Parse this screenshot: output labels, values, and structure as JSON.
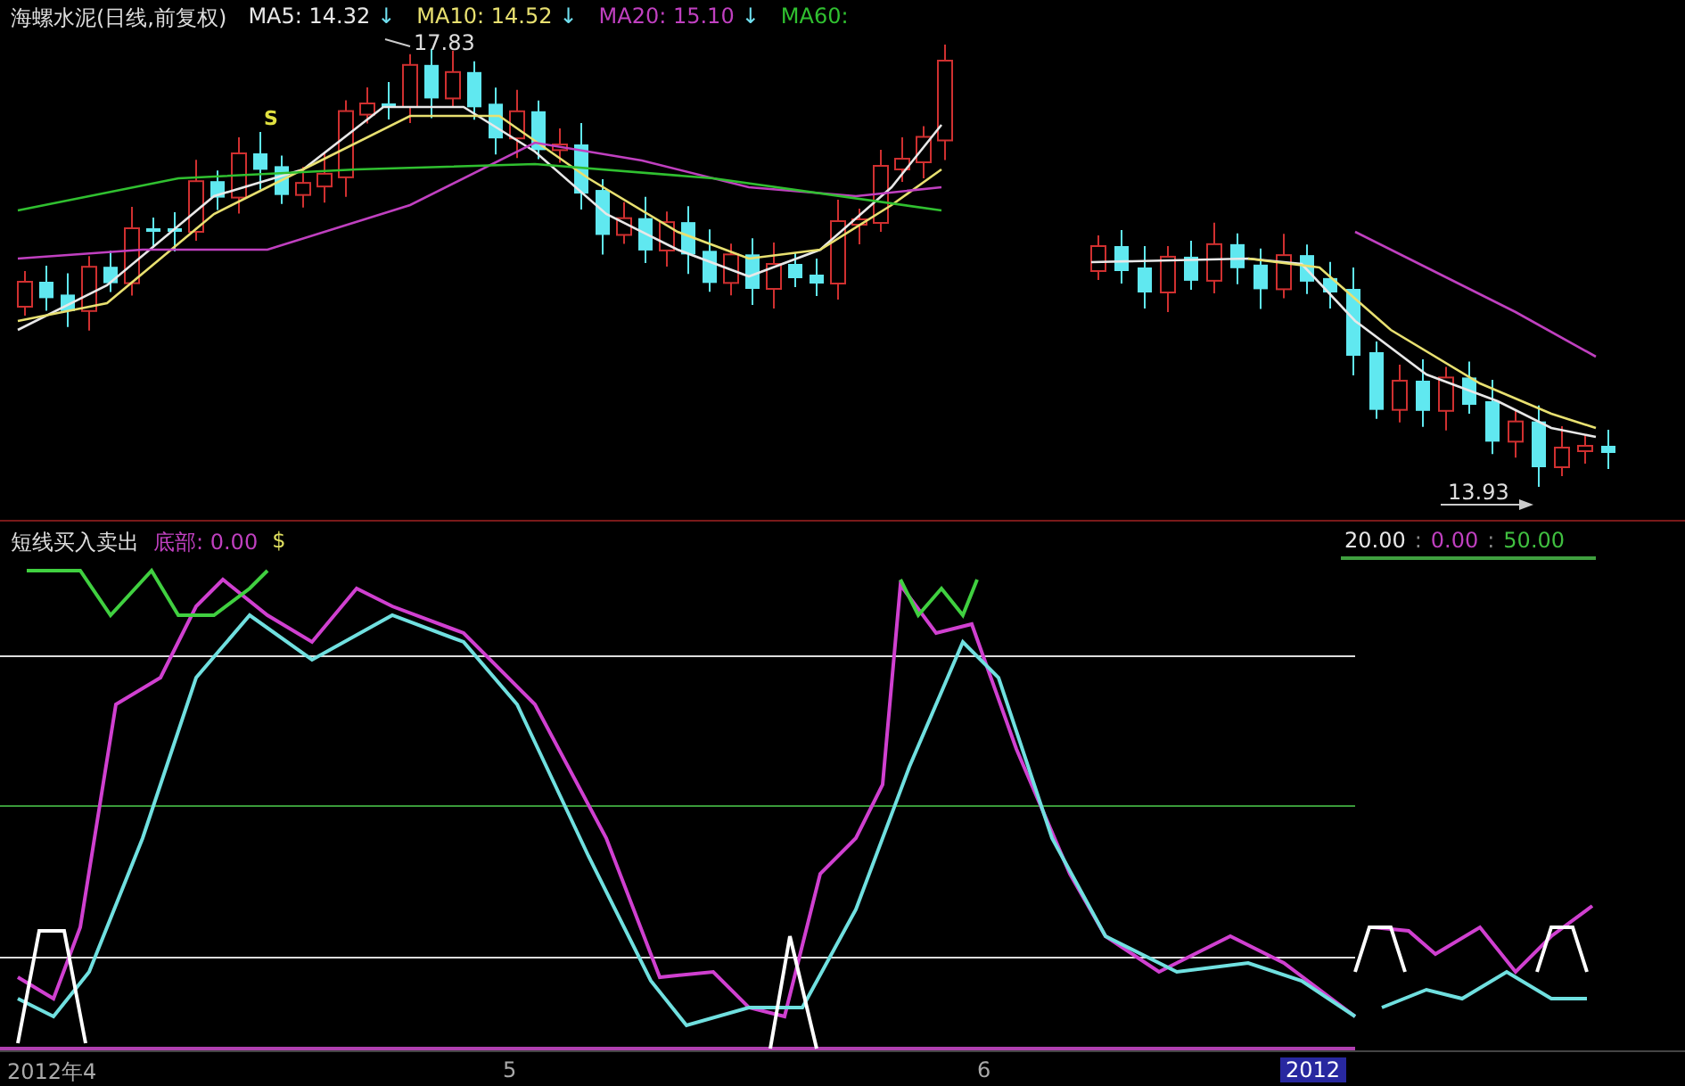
{
  "price_panel": {
    "title": "海螺水泥(日线,前复权)",
    "moving_averages": [
      {
        "label": "MA5: 14.32",
        "arrow": "↓",
        "color": "#e8e8e8"
      },
      {
        "label": "MA10: 14.52",
        "arrow": "↓",
        "color": "#e8e070"
      },
      {
        "label": "MA20: 15.10",
        "arrow": "↓",
        "color": "#c040c0"
      },
      {
        "label": "MA60:",
        "color": "#30c030"
      }
    ],
    "high_label": "17.83",
    "low_label": "13.93",
    "signal": "S"
  },
  "indicator_panel": {
    "title": "短线买入卖出",
    "bottom_reading": "底部: 0.00",
    "marker": "$",
    "levels": [
      {
        "value": "20.00",
        "color": "#e8e8e8"
      },
      {
        "value": "0.00",
        "color": "#c040c0"
      },
      {
        "value": "50.00",
        "color": "#40c040"
      }
    ],
    "separators": [
      ":",
      ":"
    ]
  },
  "time_axis": {
    "labels": [
      {
        "text": "2012年4",
        "selected": false
      },
      {
        "text": "5",
        "selected": false
      },
      {
        "text": "6",
        "selected": false
      },
      {
        "text": "2012",
        "selected": true
      }
    ]
  }
}
